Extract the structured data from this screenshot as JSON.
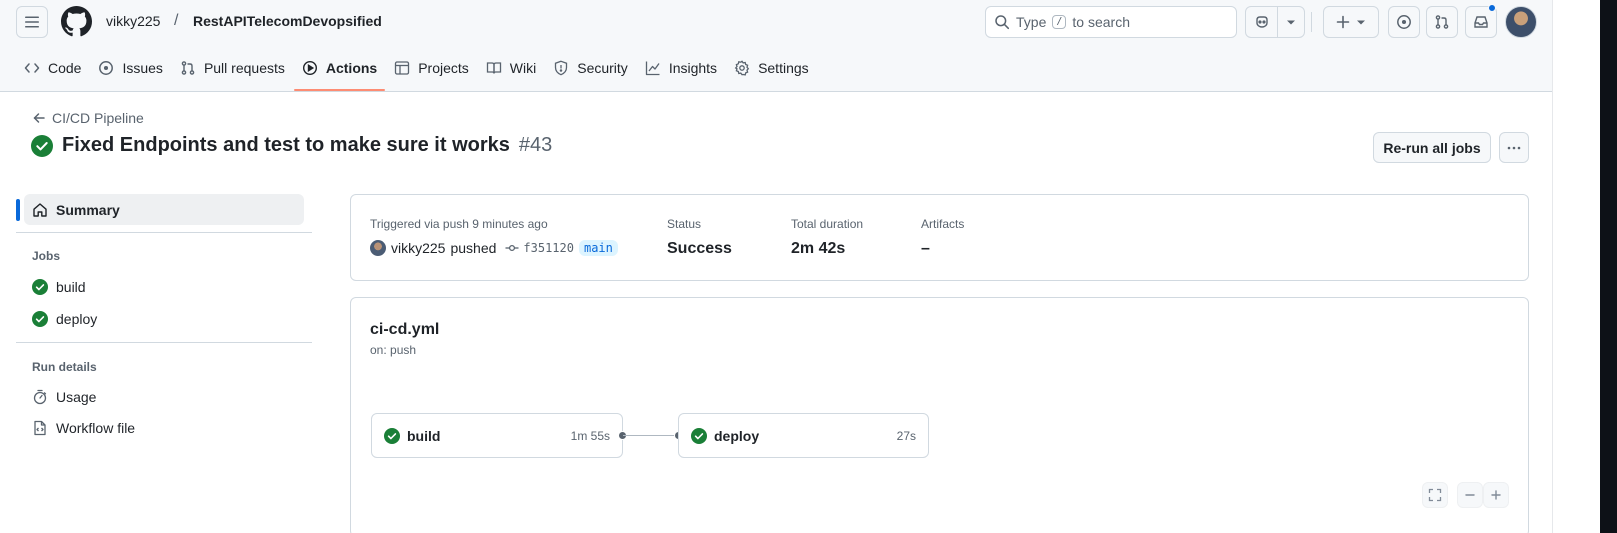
{
  "header": {
    "owner": "vikky225",
    "separator": "/",
    "repo": "RestAPITelecomDevopsified",
    "search": {
      "prefix": "Type",
      "key": "/",
      "suffix": "to search"
    }
  },
  "tabs": [
    {
      "label": "Code",
      "icon": "code-icon"
    },
    {
      "label": "Issues",
      "icon": "issue-icon"
    },
    {
      "label": "Pull requests",
      "icon": "pull-request-icon"
    },
    {
      "label": "Actions",
      "icon": "play-icon",
      "active": true
    },
    {
      "label": "Projects",
      "icon": "table-icon"
    },
    {
      "label": "Wiki",
      "icon": "book-icon"
    },
    {
      "label": "Security",
      "icon": "shield-icon"
    },
    {
      "label": "Insights",
      "icon": "graph-icon"
    },
    {
      "label": "Settings",
      "icon": "gear-icon"
    }
  ],
  "run": {
    "back_label": "CI/CD Pipeline",
    "title": "Fixed Endpoints and test to make sure it works",
    "number": "#43",
    "rerun_label": "Re-run all jobs"
  },
  "sidebar": {
    "summary_label": "Summary",
    "jobs_heading": "Jobs",
    "jobs": [
      {
        "label": "build",
        "status": "success"
      },
      {
        "label": "deploy",
        "status": "success"
      }
    ],
    "details_heading": "Run details",
    "details": [
      {
        "label": "Usage",
        "icon": "stopwatch-icon"
      },
      {
        "label": "Workflow file",
        "icon": "file-icon"
      }
    ]
  },
  "summary": {
    "trigger_text": "Triggered via push 9 minutes ago",
    "actor": "vikky225",
    "action": "pushed",
    "commit": "f351120",
    "branch": "main",
    "status_label": "Status",
    "status_value": "Success",
    "duration_label": "Total duration",
    "duration_value": "2m 42s",
    "artifacts_label": "Artifacts",
    "artifacts_value": "–"
  },
  "workflow": {
    "file": "ci-cd.yml",
    "trigger": "on: push",
    "jobs": [
      {
        "name": "build",
        "duration": "1m 55s",
        "status": "success"
      },
      {
        "name": "deploy",
        "duration": "27s",
        "status": "success"
      }
    ]
  },
  "colors": {
    "success": "#1a7f37",
    "accent": "#0969da",
    "tab_underline": "#fd8c73"
  }
}
